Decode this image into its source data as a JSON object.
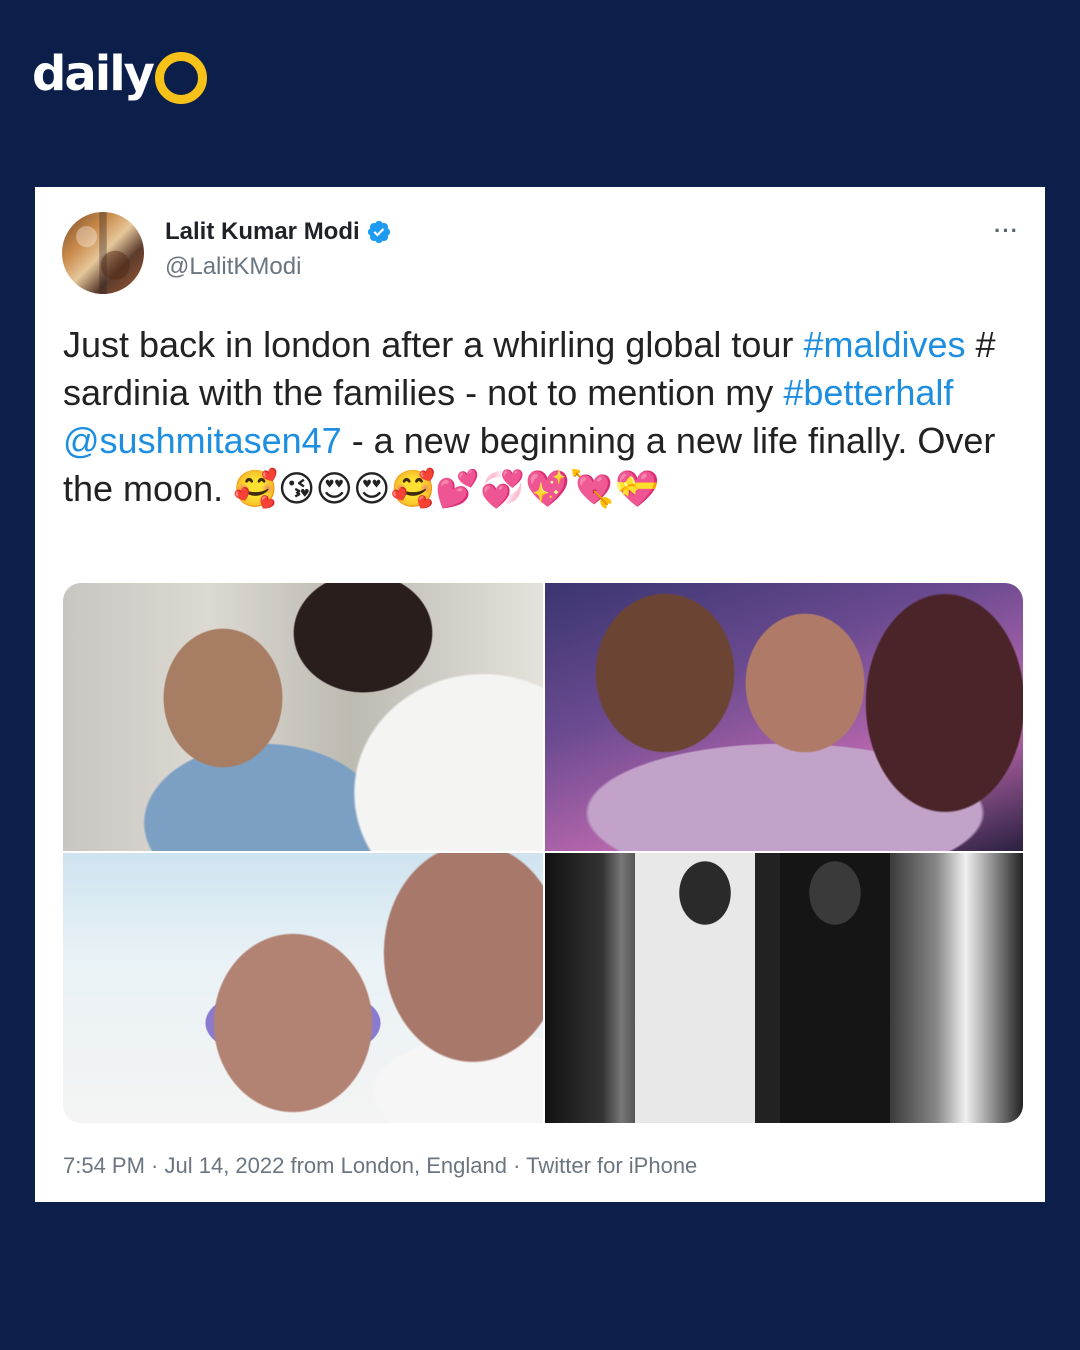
{
  "brand": {
    "text": "daily"
  },
  "tweet": {
    "author_name": "Lalit Kumar Modi",
    "handle": "@LalitKModi",
    "more_label": "···",
    "text_parts": {
      "p1": "Just back in london after a whirling global tour ",
      "link1": "#maldives",
      "p2": " # sardinia with the families - not to mention my ",
      "link2": "#betterhalf",
      "p3": " ",
      "link3": "@sushmitasen47",
      "p4": " - a new beginning a new life finally. Over the moon. ",
      "emojis": "🥰😘😍😍🥰💕💞💖💘💝"
    },
    "timestamp": "7:54 PM · Jul 14, 2022 from London, England · Twitter for iPhone"
  },
  "colors": {
    "background": "#0c1f4a",
    "accent_yellow": "#f6c21a",
    "link_blue": "#1d8ee0",
    "verified_blue": "#1d9bf0"
  },
  "icons": [
    "verified-badge-icon",
    "more-options-icon"
  ]
}
